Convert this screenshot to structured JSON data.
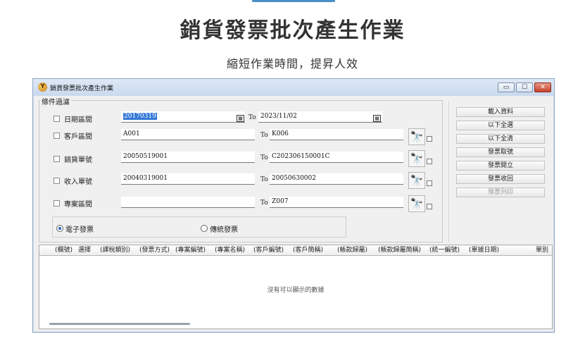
{
  "page": {
    "title": "銷貨發票批次產生作業",
    "subtitle": "縮短作業時間，提昇人效"
  },
  "window": {
    "title": "銷貨發票批次產生作業",
    "controls": {
      "minimize": "▭",
      "maximize": "☐",
      "close": "✕"
    }
  },
  "filter": {
    "group_label": "條件過濾",
    "to_label": "To",
    "rows": [
      {
        "label": "日期區間",
        "from": "20170319",
        "to": "2023/11/02"
      },
      {
        "label": "客戶區間",
        "from": "A001",
        "to": "K006"
      },
      {
        "label": "銷貨單號",
        "from": "20050519001",
        "to": "C202306150001C"
      },
      {
        "label": "收入單號",
        "from": "20040319001",
        "to": "20050630002"
      },
      {
        "label": "專案區間",
        "from": "",
        "to": "Z007"
      }
    ],
    "radios": [
      {
        "label": "電子發票",
        "selected": true
      },
      {
        "label": "傳統發票",
        "selected": false
      }
    ]
  },
  "actions": [
    {
      "label": "載入資料",
      "enabled": true
    },
    {
      "label": "以下全選",
      "enabled": true
    },
    {
      "label": "以下全清",
      "enabled": true
    },
    {
      "label": "發票取號",
      "enabled": true
    },
    {
      "label": "發票開立",
      "enabled": true
    },
    {
      "label": "發票收回",
      "enabled": true
    },
    {
      "label": "發票列印",
      "enabled": false
    }
  ],
  "grid": {
    "columns": [
      "(欄號)",
      "選擇",
      "(課稅類別)",
      "(發票方式)",
      "(專案編號)",
      "(專案名稱)",
      "(客戶編號)",
      "(客戶簡稱)",
      "(帳款歸屬)",
      "(帳款歸屬簡稱)",
      "(統一編號)",
      "(單據日期)",
      "單別"
    ],
    "empty_message": "沒有可以顯示的數據"
  },
  "icons": {
    "app": "app-logo-icon",
    "calendar": "calendar-icon",
    "search": "binoculars-icon",
    "binoculars_glyph": "🔭"
  }
}
